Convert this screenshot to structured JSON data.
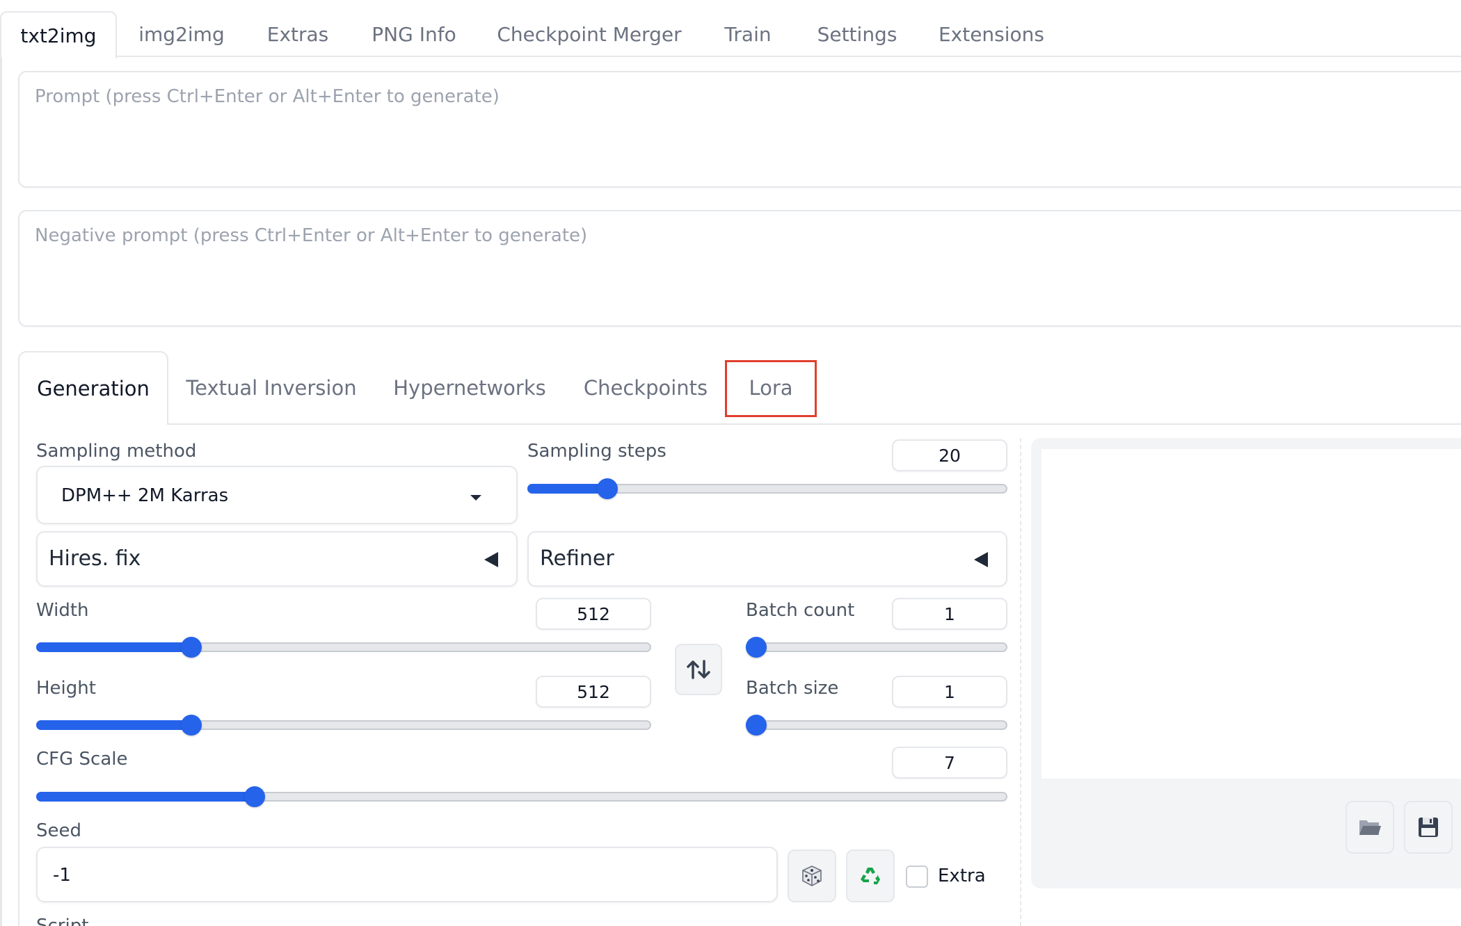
{
  "top_tabs": [
    {
      "label": "txt2img",
      "active": true
    },
    {
      "label": "img2img"
    },
    {
      "label": "Extras"
    },
    {
      "label": "PNG Info"
    },
    {
      "label": "Checkpoint Merger"
    },
    {
      "label": "Train"
    },
    {
      "label": "Settings"
    },
    {
      "label": "Extensions"
    }
  ],
  "prompt": {
    "placeholder": "Prompt (press Ctrl+Enter or Alt+Enter to generate)",
    "value": ""
  },
  "negative_prompt": {
    "placeholder": "Negative prompt (press Ctrl+Enter or Alt+Enter to generate)",
    "value": ""
  },
  "sub_tabs": [
    {
      "label": "Generation",
      "active": true
    },
    {
      "label": "Textual Inversion"
    },
    {
      "label": "Hypernetworks"
    },
    {
      "label": "Checkpoints"
    },
    {
      "label": "Lora",
      "highlighted": true
    }
  ],
  "sampling_method": {
    "label": "Sampling method",
    "value": "DPM++ 2M Karras"
  },
  "sampling_steps": {
    "label": "Sampling steps",
    "value": "20",
    "fraction": 0.145
  },
  "hires_fix": {
    "label": "Hires. fix"
  },
  "refiner": {
    "label": "Refiner"
  },
  "width": {
    "label": "Width",
    "value": "512",
    "fraction": 0.235
  },
  "height": {
    "label": "Height",
    "value": "512",
    "fraction": 0.235
  },
  "batch_count": {
    "label": "Batch count",
    "value": "1",
    "fraction": 0.0
  },
  "batch_size": {
    "label": "Batch size",
    "value": "1",
    "fraction": 0.0
  },
  "cfg_scale": {
    "label": "CFG Scale",
    "value": "7",
    "fraction": 0.214
  },
  "seed": {
    "label": "Seed",
    "value": "-1"
  },
  "extra": {
    "label": "Extra",
    "checked": false
  },
  "script": {
    "label": "Script"
  },
  "icons": {
    "swap": "swap-arrows-icon",
    "dice": "dice-icon",
    "recycle": "recycle-icon",
    "folder": "folder-icon",
    "save": "save-icon"
  },
  "colors": {
    "accent": "#2563eb",
    "highlight_box": "#e03e2d"
  }
}
